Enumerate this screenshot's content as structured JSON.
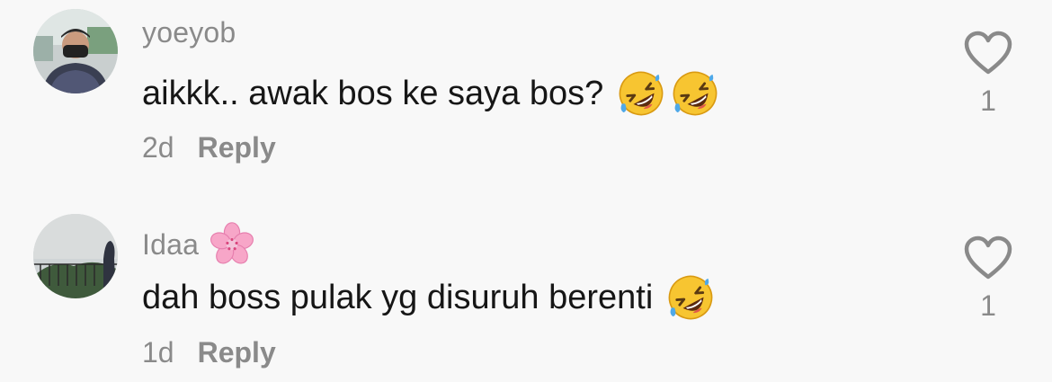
{
  "comments": [
    {
      "username": "yoeyob",
      "text": "aikkk.. awak bos ke saya bos?",
      "emoji": [
        "rolling-on-floor-laughing",
        "rolling-on-floor-laughing"
      ],
      "time": "2d",
      "reply_label": "Reply",
      "like_count": "1",
      "avatar_icon": "profile-photo-masked-man"
    },
    {
      "username": "Idaa",
      "username_emoji": "cherry-blossom",
      "text": "dah boss pulak yg disuruh berenti",
      "emoji": [
        "rolling-on-floor-laughing"
      ],
      "time": "1d",
      "reply_label": "Reply",
      "like_count": "1",
      "avatar_icon": "profile-photo-landscape"
    }
  ],
  "colors": {
    "background": "#f8f8f8",
    "text": "#161616",
    "muted": "#8a8a8a"
  }
}
